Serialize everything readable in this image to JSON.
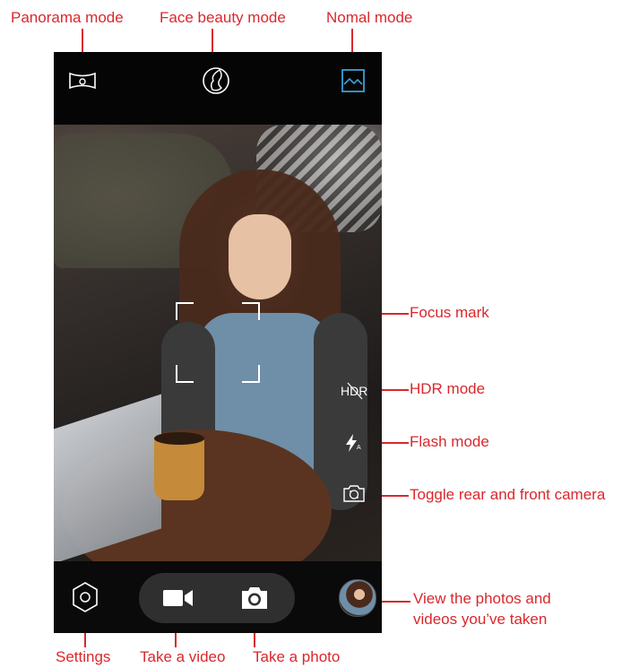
{
  "callouts": {
    "panorama_mode": "Panorama mode",
    "face_beauty_mode": "Face beauty mode",
    "normal_mode": "Nomal mode",
    "focus_mark": "Focus mark",
    "hdr_mode": "HDR mode",
    "flash_mode": "Flash mode",
    "toggle_camera": "Toggle rear and front camera",
    "view_photos_line1": "View the photos and",
    "view_photos_line2": "videos you’ve taken",
    "settings": "Settings",
    "take_video": "Take a video",
    "take_photo": "Take a photo"
  },
  "camera": {
    "hdr_label": "HDR",
    "flash_sub": "A"
  },
  "colors": {
    "callout": "#d9282d",
    "active_mode": "#3aa0d8",
    "icon": "#ffffff"
  },
  "icons": {
    "panorama": "panorama-icon",
    "face_beauty": "face-beauty-icon",
    "normal": "normal-mode-icon",
    "flash": "flash-auto-icon",
    "switch_camera": "switch-camera-icon",
    "settings": "gear-icon",
    "video": "video-camera-icon",
    "photo": "camera-icon",
    "gallery": "gallery-thumbnail"
  }
}
